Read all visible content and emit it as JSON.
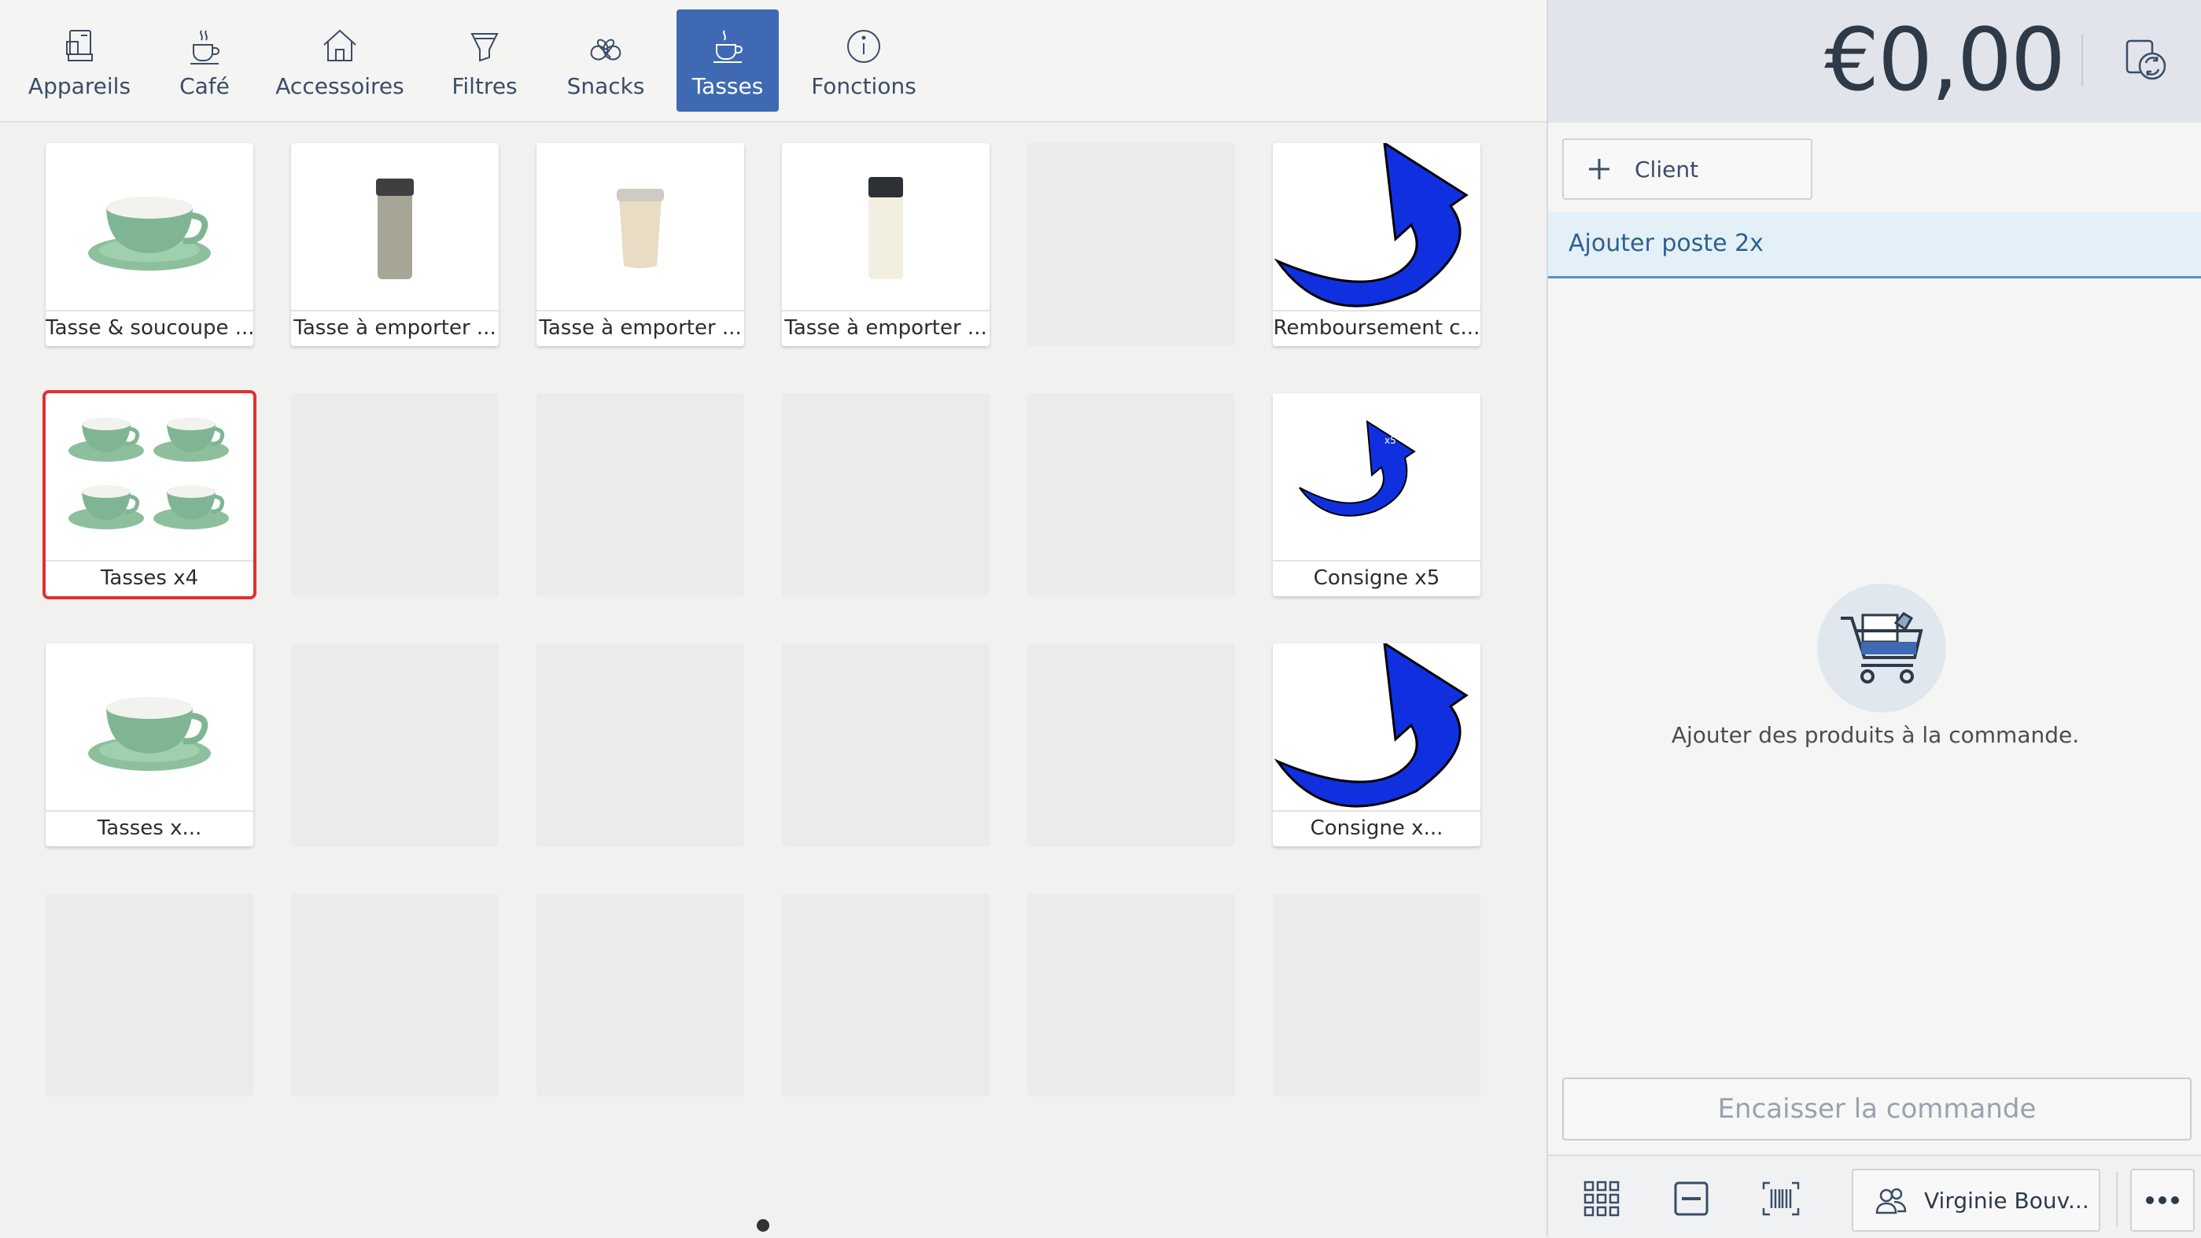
{
  "tabs": [
    {
      "label": "Appareils",
      "icon": "coffee-machine-icon"
    },
    {
      "label": "Café",
      "icon": "coffee-cup-icon"
    },
    {
      "label": "Accessoires",
      "icon": "house-icon"
    },
    {
      "label": "Filtres",
      "icon": "filter-icon"
    },
    {
      "label": "Snacks",
      "icon": "pretzel-icon"
    },
    {
      "label": "Tasses",
      "icon": "cup-icon",
      "active": true
    },
    {
      "label": "Fonctions",
      "icon": "info-icon"
    }
  ],
  "products": {
    "p1": "Tasse & soucoupe ...",
    "p2": "Tasse à emporter ...",
    "p3": "Tasse à emporter ...",
    "p4": "Tasse à emporter ...",
    "p5": "Remboursement c...",
    "p6": "Tasses x4",
    "p7": "Consigne x5",
    "p7_badge": "x5",
    "p8": "Tasses x...",
    "p9": "Consigne x..."
  },
  "order": {
    "total": "€0,00",
    "client_label": "Client",
    "notice": "Ajouter poste 2x",
    "empty_text": "Ajouter des produits à la commande.",
    "checkout_label": "Encaisser la commande",
    "user_name": "Virginie Bouv..."
  },
  "colors": {
    "accent": "#3f6ab3",
    "selection": "#e03030",
    "arrow_blue": "#1030e0"
  }
}
